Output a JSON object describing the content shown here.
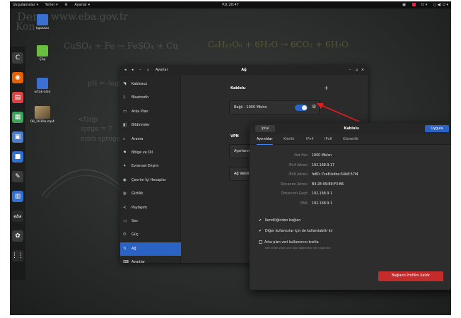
{
  "topbar": {
    "apps": "Uygulamalar ▾",
    "places": "Yerler ▾",
    "settings_menu": "Ayarlar ▾",
    "clock": "Pzt 20:47",
    "keyboard": "tr ▾",
    "status": "◻ ◀) ⏻ ▾"
  },
  "chalkboard": {
    "line1": "Ders",
    "line2": "Kon",
    "url": "www.eba.gov.tr",
    "eq": "CuSO₄ + Fe → FeSO₄ + Cu",
    "eq2": "C₆H₁₂O₆ + 6H₂O → 6CO₂ + 6H₂O",
    "note1": "pH = -log[H⁺]",
    "note2": "<tinp",
    "note3": "sprge = 7",
    "note4": "ecnb sproge"
  },
  "desktop_icons": [
    {
      "label": "kgazazu",
      "color": "#3b6fd1"
    },
    {
      "label": "Çöp",
      "color": "#6abf3e"
    },
    {
      "label": "ortak-alan",
      "color": "#3b6fd1"
    },
    {
      "label": "08_2010a.mp4",
      "color": "#8a7a5a"
    }
  ],
  "dock": [
    {
      "icon": "chrome-icon",
      "glyph": "C",
      "color": "#3a3a3a"
    },
    {
      "icon": "firefox-icon",
      "glyph": "◉",
      "color": "#e66000"
    },
    {
      "icon": "document-viewer-icon",
      "glyph": "▤",
      "color": "#e04040"
    },
    {
      "icon": "spreadsheet-icon",
      "glyph": "▦",
      "color": "#3aa55a"
    },
    {
      "icon": "presentation-icon",
      "glyph": "▣",
      "color": "#4a7fd0"
    },
    {
      "icon": "text-editor-icon",
      "glyph": "■",
      "color": "#2f6fd6"
    },
    {
      "icon": "pen-icon",
      "glyph": "✎",
      "color": "#3a3a3a"
    },
    {
      "icon": "screen-icon",
      "glyph": "▥",
      "color": "#2f6fd6"
    },
    {
      "icon": "eba-icon",
      "glyph": "eba",
      "color": "#2a2a2a"
    },
    {
      "icon": "android-icon",
      "glyph": "✿",
      "color": "#3a3a3a"
    },
    {
      "icon": "app-grid-icon",
      "glyph": "⋮⋮",
      "color": "#2a2a2a"
    }
  ],
  "settings_window": {
    "search_label": "Ayarlar",
    "title": "Ağ",
    "sidebar": [
      {
        "icon": "wifi-icon",
        "glyph": "◥",
        "label": "Kablosuz"
      },
      {
        "icon": "bluetooth-icon",
        "glyph": "ᛒ",
        "label": "Bluetooth"
      },
      {
        "icon": "background-icon",
        "glyph": "▭",
        "label": "Arka Plan"
      },
      {
        "icon": "notifications-icon",
        "glyph": "◧",
        "label": "Bildirimler"
      },
      {
        "icon": "search-icon",
        "glyph": "⌕",
        "label": "Arama"
      },
      {
        "icon": "region-language-icon",
        "glyph": "⚑",
        "label": "Bölge ve Dil"
      },
      {
        "icon": "universal-access-icon",
        "glyph": "✦",
        "label": "Evrensel Erişim"
      },
      {
        "icon": "online-accounts-icon",
        "glyph": "◉",
        "label": "Çevrim İçi Hesaplar"
      },
      {
        "icon": "privacy-icon",
        "glyph": "◍",
        "label": "Gizlilik"
      },
      {
        "icon": "sharing-icon",
        "glyph": "≺",
        "label": "Paylaşım"
      },
      {
        "icon": "sound-icon",
        "glyph": "◁",
        "label": "Ses"
      },
      {
        "icon": "power-icon",
        "glyph": "⏻",
        "label": "Güç"
      },
      {
        "icon": "network-icon",
        "glyph": "⇅",
        "label": "Ağ"
      },
      {
        "icon": "devices-icon",
        "glyph": "⌨",
        "label": "Aygıtlar"
      }
    ],
    "wired": {
      "heading": "Kablolu",
      "add": "+",
      "connection": "Bağlı - 1000 Mb/sn"
    },
    "vpn": {
      "heading": "VPN",
      "off_label": "Ayarlanmamış"
    },
    "proxy": {
      "label": "Ağ Vekili"
    }
  },
  "dialog": {
    "cancel": "İptal",
    "title": "Kablolu",
    "apply": "Uygula",
    "tabs": [
      "Ayrıntılar",
      "Kimlik",
      "IPv4",
      "IPv6",
      "Güvenlik"
    ],
    "details": [
      {
        "label": "Hat Hızı",
        "value": "1000 Mb/sn"
      },
      {
        "label": "IPv4 Adresi",
        "value": "192.168.9.17"
      },
      {
        "label": "IPv6 Adresi",
        "value": "fe80::7ce8:bdba:54b8:57f4"
      },
      {
        "label": "Donanım Adresi",
        "value": "B4:2E:99:B9:F3:B6"
      },
      {
        "label": "Öntanımlı Geçit",
        "value": "192.168.9.1"
      },
      {
        "label": "DNS",
        "value": "192.168.9.1"
      }
    ],
    "checks": [
      {
        "checked": true,
        "label": "Kendiliğinden bağlan"
      },
      {
        "checked": true,
        "label": "Diğer kullanıcılar için de kullanılabilir kıl"
      },
      {
        "checked": false,
        "label": "Arka plan veri kullanımını kısıtla"
      }
    ],
    "check_hint": "Dek bulan veya ucuz olan bağlantılar için uygundur",
    "remove": "Bağlantı Profilini Kaldır"
  }
}
